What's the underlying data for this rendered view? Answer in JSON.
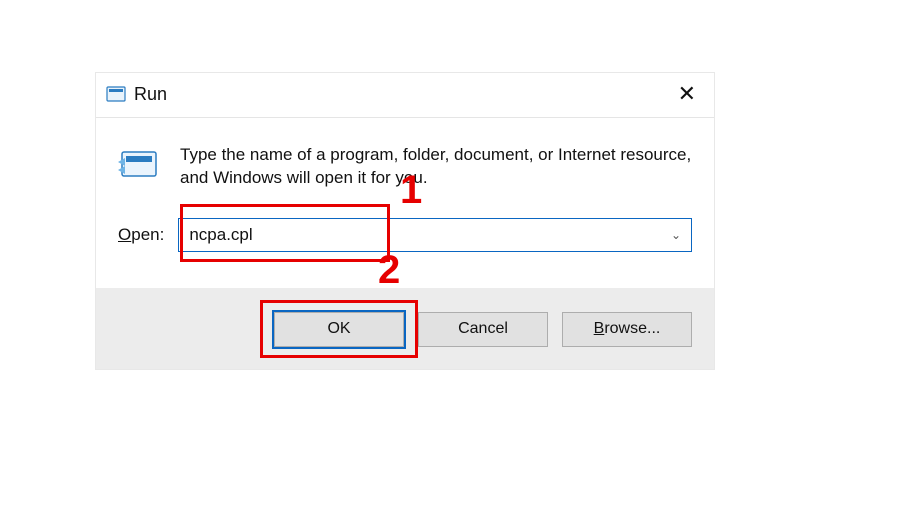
{
  "dialog": {
    "title": "Run",
    "message": "Type the name of a program, folder, document, or Internet resource, and Windows will open it for you.",
    "open_label_pre": "O",
    "open_label_post": "pen:",
    "input_value": "ncpa.cpl",
    "buttons": {
      "ok": "OK",
      "cancel": "Cancel",
      "browse_pre": "B",
      "browse_post": "rowse..."
    }
  },
  "annotations": {
    "label1": "1",
    "label2": "2"
  }
}
